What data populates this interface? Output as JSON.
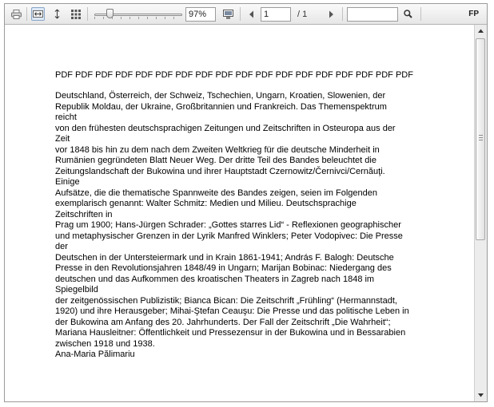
{
  "toolbar": {
    "zoom_value": "97%",
    "page_input_value": "1",
    "page_total": "/ 1",
    "search_value": "",
    "fp_label": "FP",
    "zoom_level_fraction": 0.18,
    "icons": [
      "printer-icon",
      "fit-width-icon",
      "fit-height-icon",
      "thumbnails-icon",
      "zoom-slider",
      "display-mode-icon",
      "prev-page-icon",
      "next-page-icon",
      "search-icon"
    ]
  },
  "document": {
    "heading": "PDF PDF PDF PDF PDF PDF PDF PDF PDF PDF PDF PDF PDF PDF PDF PDF PDF PDF",
    "lines": [
      "Deutschland, Österreich, der Schweiz, Tschechien, Ungarn, Kroatien, Slowenien, der",
      "Republik Moldau, der Ukraine, Großbritannien und Frankreich. Das Themenspektrum",
      "reicht",
      "von den frühesten deutschsprachigen Zeitungen und Zeitschriften in Osteuropa aus der",
      "Zeit",
      "vor 1848 bis hin zu dem nach dem Zweiten Weltkrieg für die deutsche Minderheit in",
      "Rumänien gegründeten Blatt Neuer Weg. Der dritte Teil des Bandes beleuchtet die",
      "Zeitungslandschaft der Bukowina und ihrer Hauptstadt Czernowitz/Černivci/Cernăuţi.",
      "Einige",
      "Aufsätze, die die thematische Spannweite des Bandes zeigen, seien im Folgenden",
      "exemplarisch genannt: Walter Schmitz: Medien und Milieu. Deutschsprachige",
      "Zeitschriften in",
      "Prag um 1900; Hans-Jürgen Schrader: „Gottes starres Lid“ - Reflexionen geographischer",
      "und metaphysischer Grenzen in der Lyrik Manfred Winklers; Peter Vodopivec: Die Presse",
      "der",
      "Deutschen in der Untersteiermark und in Krain 1861-1941; András F. Balogh: Deutsche",
      "Presse in den Revolutionsjahren 1848/49 in Ungarn; Marijan Bobinac: Niedergang des",
      "deutschen und das Aufkommen des kroatischen Theaters in Zagreb nach 1848 im",
      "Spiegelbild",
      "der zeitgenössischen Publizistik; Bianca Bican: Die Zeitschrift „Frühling“ (Hermannstadt,",
      "1920) und ihre Herausgeber; Mihai-Ştefan Ceauşu: Die Presse und das politische Leben in",
      "der Bukowina am Anfang des 20. Jahrhunderts. Der Fall der Zeitschrift „Die Wahrheit“;",
      "Mariana Hausleitner: Öffentlichkeit und Pressezensur in der Bukowina und in Bessarabien",
      "zwischen 1918 und 1938.",
      "Ana-Maria Pălimariu"
    ]
  },
  "scrollbar": {
    "position_fraction": 0.0,
    "visible_fraction": 0.55
  }
}
